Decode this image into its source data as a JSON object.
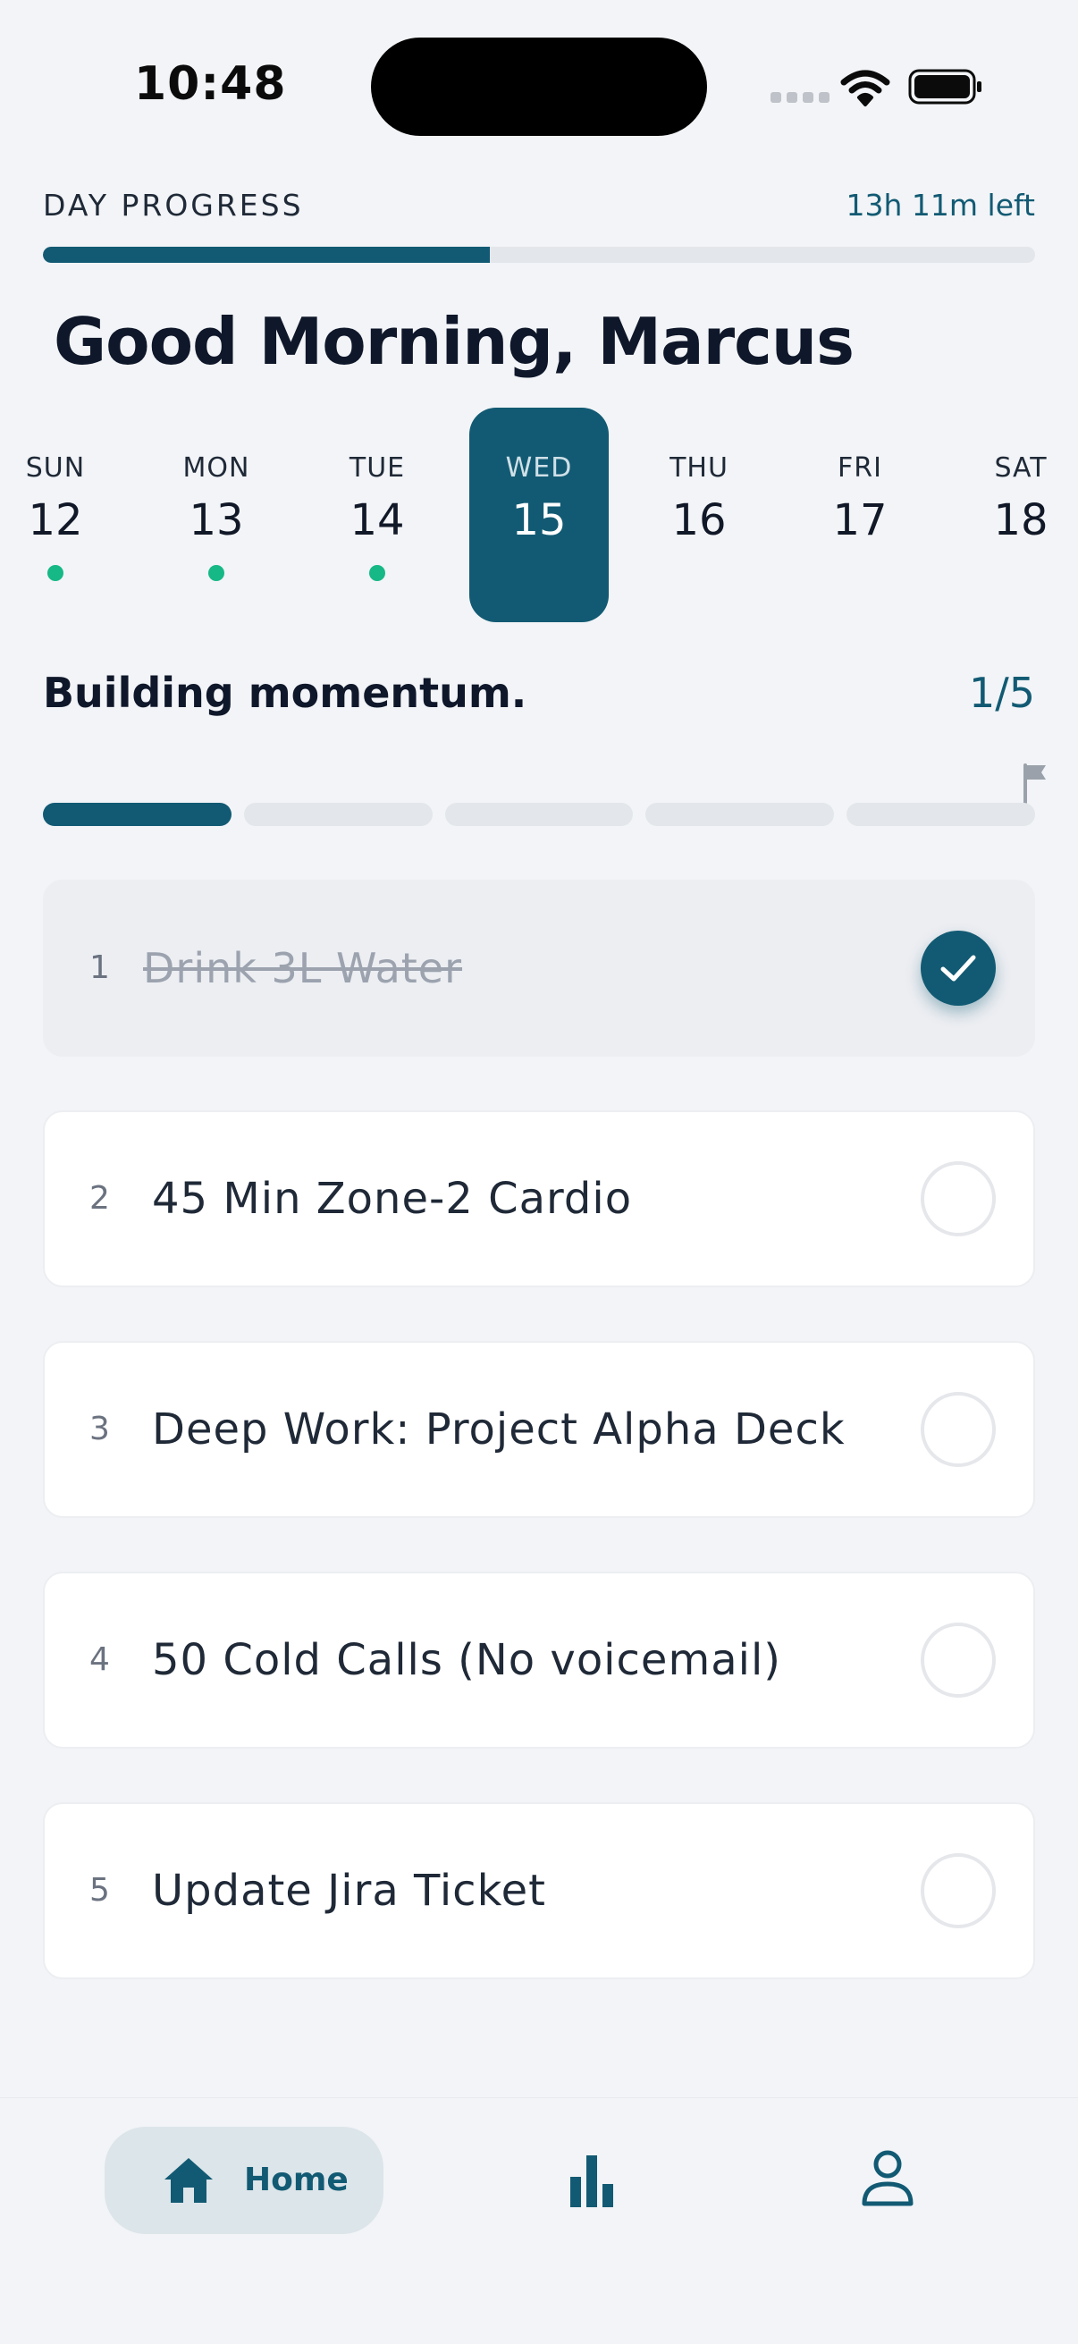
{
  "status_bar": {
    "time": "10:48"
  },
  "day_progress": {
    "label": "DAY PROGRESS",
    "time_left": "13h 11m left",
    "progress": 0.45
  },
  "greeting": "Good Morning, Marcus",
  "week": [
    {
      "dow": "SUN",
      "num": "12",
      "dot": true,
      "selected": false
    },
    {
      "dow": "MON",
      "num": "13",
      "dot": true,
      "selected": false
    },
    {
      "dow": "TUE",
      "num": "14",
      "dot": true,
      "selected": false
    },
    {
      "dow": "WED",
      "num": "15",
      "dot": false,
      "selected": true
    },
    {
      "dow": "THU",
      "num": "16",
      "dot": false,
      "selected": false
    },
    {
      "dow": "FRI",
      "num": "17",
      "dot": false,
      "selected": false
    },
    {
      "dow": "SAT",
      "num": "18",
      "dot": false,
      "selected": false
    }
  ],
  "momentum": {
    "message": "Building momentum.",
    "count": "1/5",
    "completed": 1,
    "total": 5
  },
  "tasks": [
    {
      "index": "1",
      "label": "Drink 3L Water",
      "done": true
    },
    {
      "index": "2",
      "label": "45 Min Zone-2 Cardio",
      "done": false
    },
    {
      "index": "3",
      "label": "Deep Work: Project Alpha Deck",
      "done": false
    },
    {
      "index": "4",
      "label": "50 Cold Calls (No voicemail)",
      "done": false
    },
    {
      "index": "5",
      "label": "Update Jira Ticket",
      "done": false
    }
  ],
  "nav": {
    "home_label": "Home"
  },
  "colors": {
    "accent": "#125a73",
    "dot": "#16b886",
    "background": "#f2f4f7"
  },
  "icons": [
    "wifi-icon",
    "battery-icon",
    "flag-icon",
    "check-icon",
    "home-icon",
    "bar-chart-icon",
    "profile-icon"
  ]
}
